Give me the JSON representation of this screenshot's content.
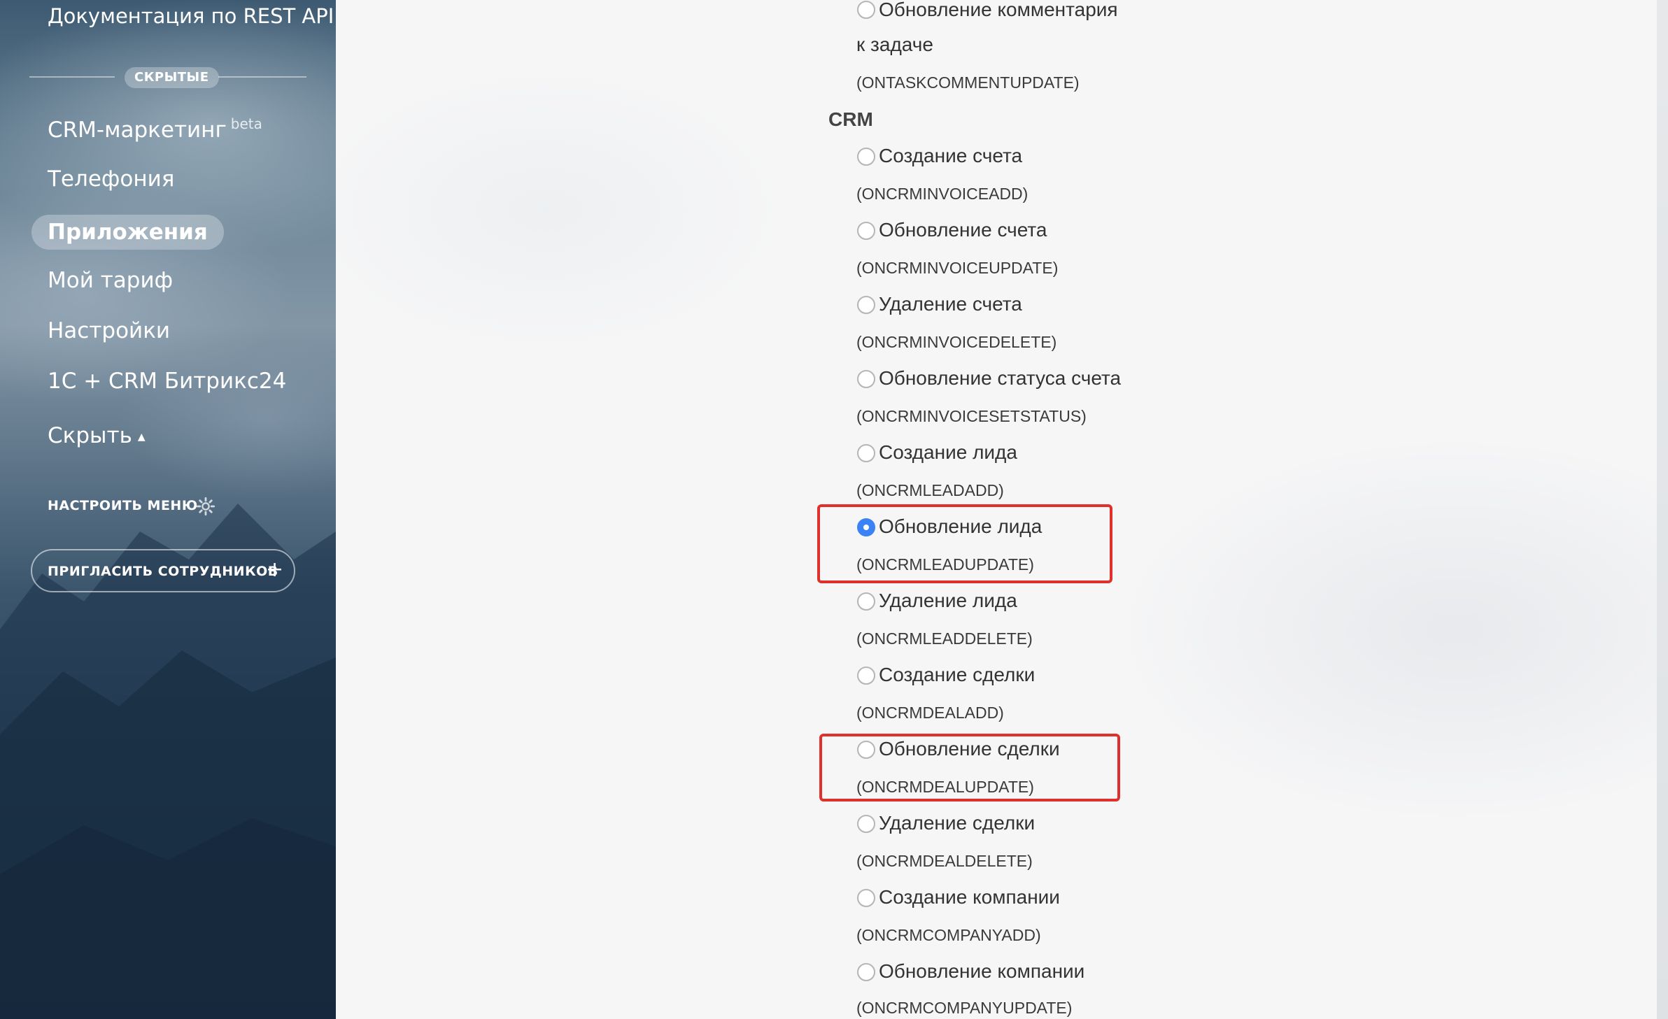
{
  "sidebar": {
    "title": "Документация по REST API",
    "hidden_label": "СКРЫТЫЕ",
    "items": [
      {
        "label": "CRM-маркетинг",
        "badge": "beta"
      },
      {
        "label": "Телефония"
      },
      {
        "label": "Приложения",
        "active": true
      },
      {
        "label": "Мой тариф"
      },
      {
        "label": "Настройки"
      },
      {
        "label": "1С + CRM Битрикс24"
      },
      {
        "label": "Скрыть"
      }
    ],
    "settings_menu": "НАСТРОИТЬ МЕНЮ",
    "invite_button": "ПРИГЛАСИТЬ СОТРУДНИКОВ",
    "invite_plus": "+"
  },
  "main": {
    "top_option": {
      "label_line1": "Обновление комментария",
      "label_line2": "к задаче",
      "code": "(ONTASKCOMMENTUPDATE)"
    },
    "section_title": "CRM",
    "options": [
      {
        "label": "Создание счета",
        "code": "(ONCRMINVOICEADD)",
        "checked": false
      },
      {
        "label": "Обновление счета",
        "code": "(ONCRMINVOICEUPDATE)",
        "checked": false
      },
      {
        "label": "Удаление счета",
        "code": "(ONCRMINVOICEDELETE)",
        "checked": false
      },
      {
        "label": "Обновление статуса счета",
        "code": "(ONCRMINVOICESETSTATUS)",
        "checked": false
      },
      {
        "label": "Создание лида",
        "code": "(ONCRMLEADADD)",
        "checked": false
      },
      {
        "label": "Обновление лида",
        "code": "(ONCRMLEADUPDATE)",
        "checked": true
      },
      {
        "label": "Удаление лида",
        "code": "(ONCRMLEADDELETE)",
        "checked": false
      },
      {
        "label": "Создание сделки",
        "code": "(ONCRMDEALADD)",
        "checked": false
      },
      {
        "label": "Обновление сделки",
        "code": "(ONCRMDEALUPDATE)",
        "checked": false
      },
      {
        "label": "Удаление сделки",
        "code": "(ONCRMDEALDELETE)",
        "checked": false
      },
      {
        "label": "Создание компании",
        "code": "(ONCRMCOMPANYADD)",
        "checked": false
      },
      {
        "label": "Обновление компании",
        "code": "(ONCRMCOMPANYUPDATE)",
        "checked": false
      }
    ]
  },
  "colors": {
    "radio_checked": "#3b82f6",
    "highlight_border": "#e0302b"
  }
}
